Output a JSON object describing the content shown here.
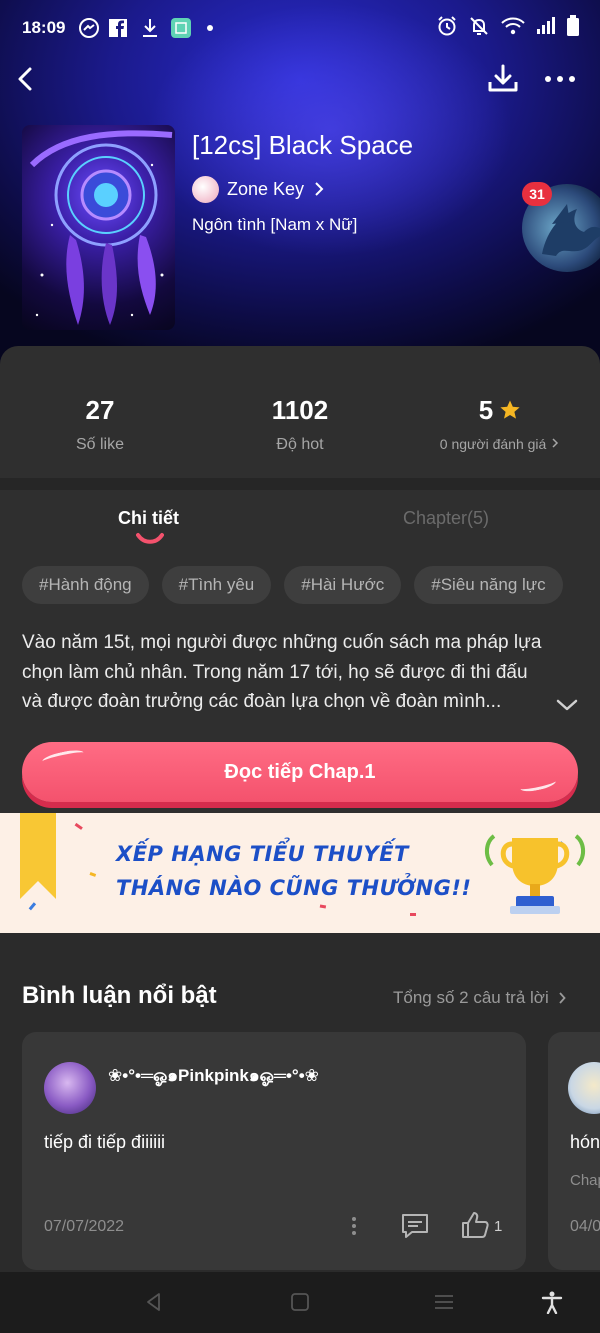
{
  "status_bar": {
    "time": "18:09",
    "left_icons": [
      "messenger-icon",
      "facebook-icon",
      "download-icon",
      "app-icon",
      "dot-icon"
    ],
    "right_icons": [
      "alarm-icon",
      "bell-off-icon",
      "wifi-icon",
      "signal-icon",
      "battery-icon"
    ]
  },
  "header": {
    "back_icon": "back-arrow-icon",
    "download_icon": "download-icon",
    "more_icon": "more-icon"
  },
  "book": {
    "title": "[12cs] Black Space",
    "author": "Zone Key",
    "genre": "Ngôn tình [Nam x Nữ]",
    "ad_badge": "31"
  },
  "stats": [
    {
      "value": "27",
      "label": "Số like"
    },
    {
      "value": "1102",
      "label": "Độ hot"
    },
    {
      "value": "5",
      "label": "0 người đánh giá"
    }
  ],
  "tabs": {
    "detail": "Chi tiết",
    "chapters": "Chapter(5)"
  },
  "tags": [
    "#Hành động",
    "#Tình yêu",
    "#Hài Hước",
    "#Siêu năng lực"
  ],
  "synopsis": "Vào năm 15t, mọi người được những cuốn sách ma pháp lựa chọn làm chủ nhân. Trong năm 17 tới, họ sẽ được đi thi đấu và được đoàn trưởng các đoàn lựa chọn về đoàn mình...",
  "read_button": "Đọc tiếp Chap.1",
  "banner": {
    "line1": "XẾP HẠNG TIỂU THUYẾT",
    "line2": "THÁNG NÀO CŨNG THƯỞNG!!"
  },
  "comments_section": {
    "title": "Bình luận nổi bật",
    "total": "Tổng số 2 câu trả lời"
  },
  "comments": [
    {
      "user": "❀•°•═ஓ๑Pinkpink๑ஓ═•°•❀",
      "text": "tiếp đi tiếp điiiiii",
      "date": "07/07/2022",
      "likes": "1"
    },
    {
      "text": "hón",
      "sub": "Chap",
      "date": "04/0"
    }
  ],
  "colors": {
    "accent": "#f4526d",
    "banner_text": "#1c4fc7",
    "card_bg": "#383838",
    "page_bg": "#2f2f2f"
  }
}
